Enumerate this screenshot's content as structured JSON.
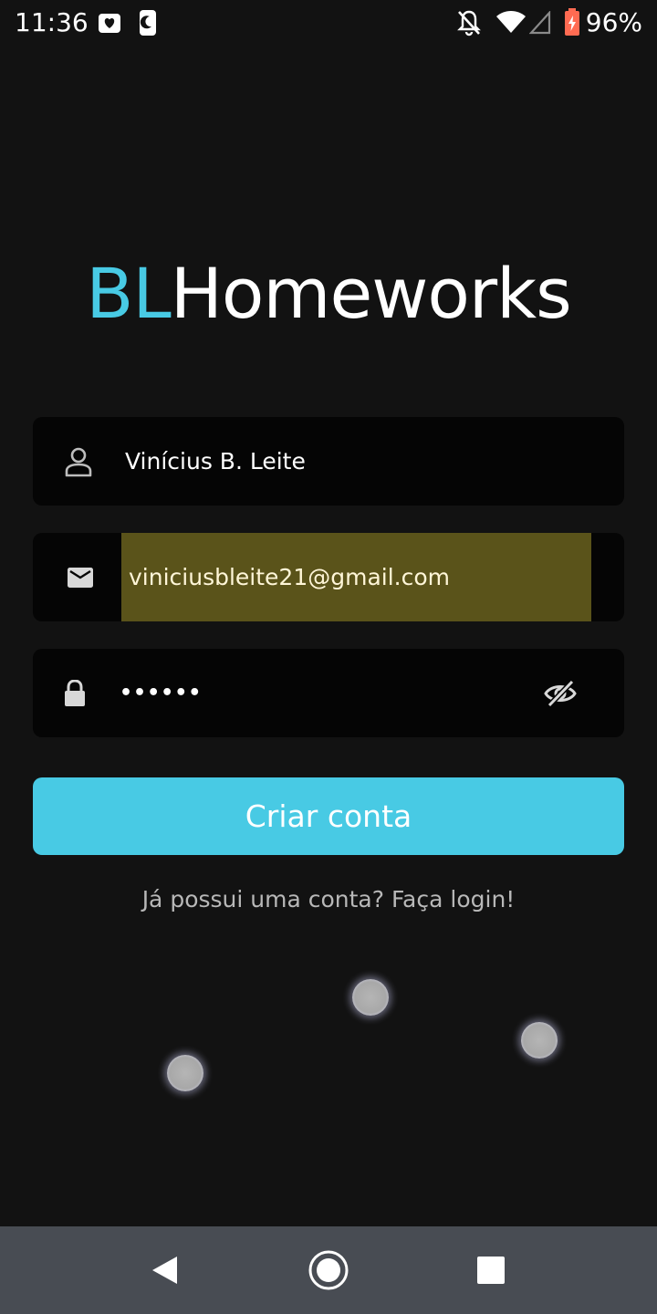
{
  "status_bar": {
    "time": "11:36",
    "battery_percent": "96%",
    "icons": [
      "alarm-clock-icon",
      "dnd-moon-icon",
      "notifications-off-icon",
      "wifi-icon",
      "cell-signal-icon",
      "battery-charging-icon"
    ]
  },
  "logo": {
    "accent": "BL",
    "main": "Homeworks"
  },
  "form": {
    "name_value": "Vinícius B. Leite",
    "email_value": "viniciusbleite21@gmail.com",
    "password_value": "••••••"
  },
  "actions": {
    "create_account_label": "Criar conta",
    "login_link_label": "Já possui uma conta? Faça login!"
  },
  "nav": {
    "icons": [
      "back-icon",
      "home-icon",
      "recents-icon"
    ]
  },
  "colors": {
    "accent": "#48cae4",
    "background": "#121212",
    "field_background": "#050505",
    "autofill_highlight": "#5a531a",
    "nav_background": "#484c53"
  }
}
